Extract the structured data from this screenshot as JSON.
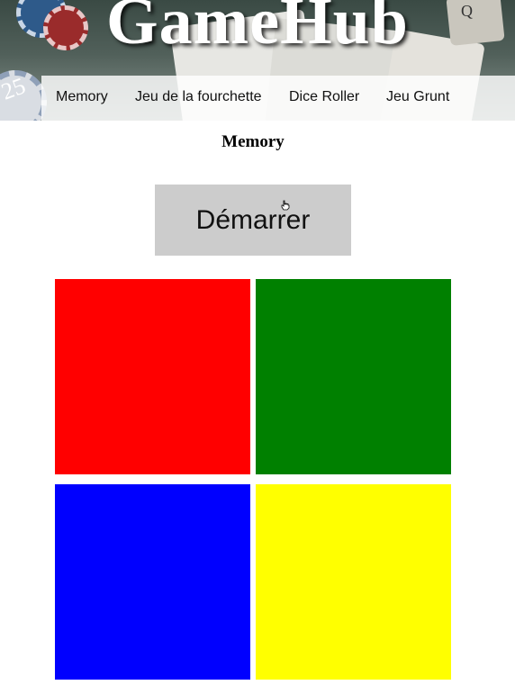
{
  "header": {
    "site_title": "GameHub",
    "background_icons": {
      "dice_label": "Q",
      "chip_label": "25"
    }
  },
  "nav": {
    "items": [
      {
        "label": "Memory"
      },
      {
        "label": "Jeu de la fourchette"
      },
      {
        "label": "Dice Roller"
      },
      {
        "label": "Jeu Grunt"
      }
    ]
  },
  "main": {
    "title": "Memory",
    "start_button_label": "Démarrer",
    "tiles": [
      {
        "name": "red",
        "color": "#ff0000"
      },
      {
        "name": "green",
        "color": "#008000"
      },
      {
        "name": "blue",
        "color": "#0000ff"
      },
      {
        "name": "yellow",
        "color": "#ffff00"
      }
    ]
  },
  "colors": {
    "button_bg": "#cccccc",
    "nav_bg": "#ffffff",
    "title_text": "#ffffff"
  }
}
